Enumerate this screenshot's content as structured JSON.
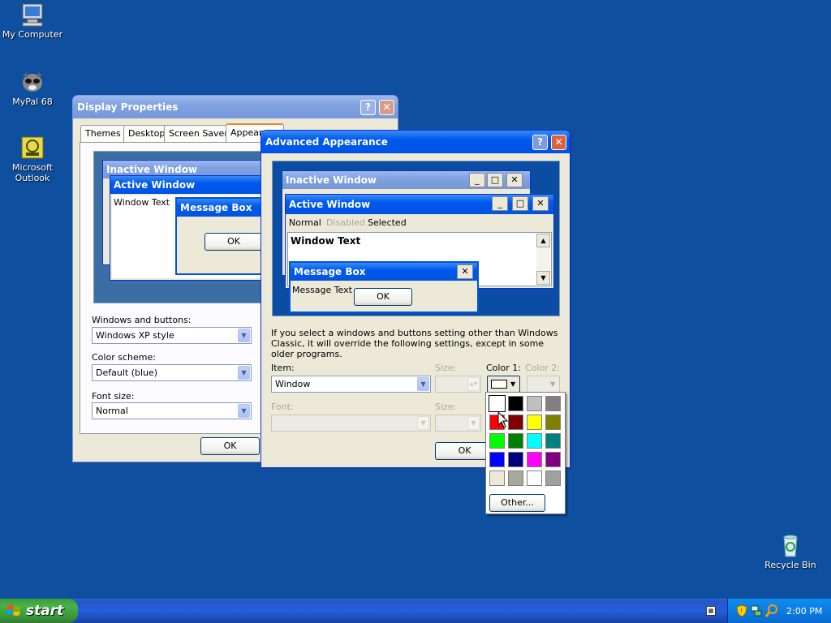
{
  "desktop": {
    "icons": [
      {
        "label": "My Computer",
        "icon": "my-computer-icon"
      },
      {
        "label": "MyPal 68",
        "icon": "mypal-icon"
      },
      {
        "label": "Microsoft Outlook",
        "icon": "outlook-icon"
      },
      {
        "label": "Recycle Bin",
        "icon": "recycle-bin-icon"
      }
    ]
  },
  "display_properties": {
    "title": "Display Properties",
    "help": "?",
    "close": "✕",
    "tabs": [
      "Themes",
      "Desktop",
      "Screen Saver",
      "Appearance"
    ],
    "selected_tab": "Appearance",
    "preview": {
      "inactive_title": "Inactive Window",
      "active_title": "Active Window",
      "window_text": "Window Text",
      "message_title": "Message Box",
      "ok": "OK"
    },
    "windows_buttons_label": "Windows and buttons:",
    "windows_buttons_value": "Windows XP style",
    "color_scheme_label": "Color scheme:",
    "color_scheme_value": "Default (blue)",
    "font_size_label": "Font size:",
    "font_size_value": "Normal",
    "ok": "OK"
  },
  "advanced": {
    "title": "Advanced Appearance",
    "help": "?",
    "close": "✕",
    "preview": {
      "inactive_title": "Inactive Window",
      "active_title": "Active Window",
      "menu_normal": "Normal",
      "menu_disabled": "Disabled",
      "menu_selected": "Selected",
      "window_text": "Window Text",
      "message_title": "Message Box",
      "message_text": "Message Text",
      "ok": "OK"
    },
    "info": "If you select a windows and buttons setting other than Windows Classic, it will override the following settings, except in some older programs.",
    "item_label": "Item:",
    "item_value": "Window",
    "size_label": "Size:",
    "color1_label": "Color 1:",
    "color2_label": "Color 2:",
    "font_label": "Font:",
    "font_size_label": "Size:",
    "ok": "OK"
  },
  "color_picker": {
    "colors": [
      "#ffffff",
      "#000000",
      "#c0c0c0",
      "#808080",
      "#ff0000",
      "#800000",
      "#ffff00",
      "#808000",
      "#00ff00",
      "#008000",
      "#00ffff",
      "#008080",
      "#0000ff",
      "#000080",
      "#ff00ff",
      "#800080",
      "#ece9d8",
      "#a8a89b",
      "#ffffff",
      "#a0a0a0"
    ],
    "selected": "#ffffff",
    "other": "Other..."
  },
  "taskbar": {
    "start": "start",
    "clock": "2:00 PM"
  }
}
